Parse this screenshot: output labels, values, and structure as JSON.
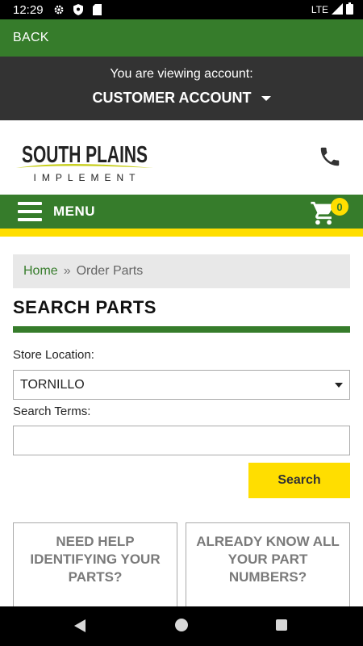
{
  "status_bar": {
    "time": "12:29",
    "network": "LTE",
    "icons": [
      "gear-icon",
      "shield-icon",
      "sd-card-icon",
      "signal-icon",
      "battery-icon"
    ]
  },
  "back_bar": {
    "label": "BACK"
  },
  "account": {
    "viewing_text": "You are viewing account:",
    "account_name": "CUSTOMER ACCOUNT"
  },
  "brand": {
    "logo_line1": "SOUTH PLAINS",
    "logo_line2": "IMPLEMENT"
  },
  "menu": {
    "label": "MENU",
    "cart_count": "0"
  },
  "breadcrumb": {
    "home": "Home",
    "separator": "»",
    "current": "Order Parts"
  },
  "page": {
    "title": "SEARCH PARTS"
  },
  "form": {
    "store_label": "Store Location:",
    "store_value": "TORNILLO",
    "search_label": "Search Terms:",
    "search_value": "",
    "search_button": "Search"
  },
  "cards": [
    {
      "text": "NEED HELP IDENTIFYING YOUR PARTS?"
    },
    {
      "text": "ALREADY KNOW ALL YOUR PART NUMBERS?"
    }
  ],
  "colors": {
    "brand_green": "#367c2b",
    "brand_yellow": "#ffde00",
    "account_bar": "#333333"
  }
}
